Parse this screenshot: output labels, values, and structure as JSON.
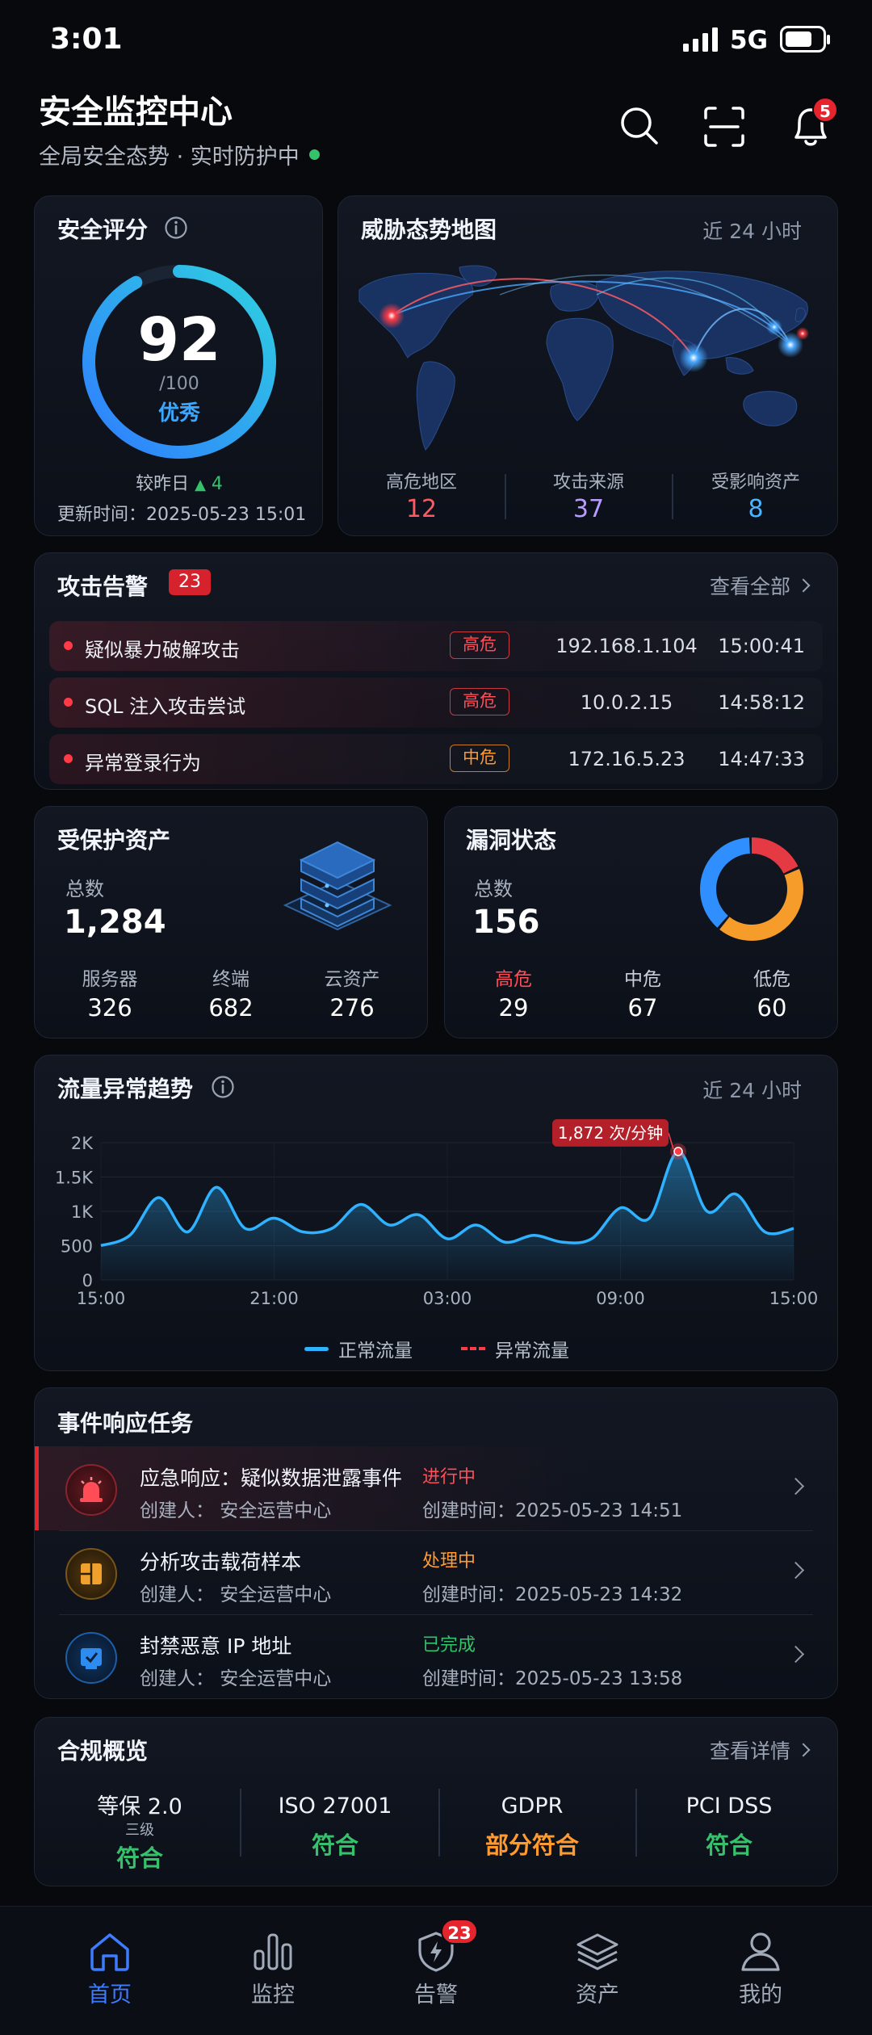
{
  "status_bar": {
    "time": "3:01",
    "network": "5G"
  },
  "header": {
    "title": "安全监控中心",
    "subtitle": "全局安全态势 · 实时防护中",
    "notification_count": "5"
  },
  "security_score": {
    "title": "安全评分",
    "score": "92",
    "max": "/100",
    "grade": "优秀",
    "compare_label": "较昨日",
    "compare_value": "4",
    "updated_label": "更新时间：",
    "updated_time": "2025-05-23 15:01",
    "percent": 0.92
  },
  "threat_map": {
    "title": "威胁态势地图",
    "range": "近 24 小时",
    "stats": [
      {
        "label": "高危地区",
        "value": "12",
        "color": "#ff5a63"
      },
      {
        "label": "攻击来源",
        "value": "37",
        "color": "#b99cff"
      },
      {
        "label": "受影响资产",
        "value": "8",
        "color": "#45b6ff"
      }
    ]
  },
  "alerts": {
    "title": "攻击告警",
    "count": "23",
    "view_all": "查看全部",
    "items": [
      {
        "title": "疑似暴力破解攻击",
        "level": "高危",
        "ip": "192.168.1.104",
        "time": "15:00:41",
        "level_color": "#ff4d57"
      },
      {
        "title": "SQL 注入攻击尝试",
        "level": "高危",
        "ip": "10.0.2.15",
        "time": "14:58:12",
        "level_color": "#ff4d57"
      },
      {
        "title": "异常登录行为",
        "level": "中危",
        "ip": "172.16.5.23",
        "time": "14:47:33",
        "level_color": "#ff9a2e"
      }
    ]
  },
  "assets": {
    "title": "受保护资产",
    "total_label": "总数",
    "total": "1,284",
    "items": [
      {
        "label": "服务器",
        "value": "326"
      },
      {
        "label": "终端",
        "value": "682"
      },
      {
        "label": "云资产",
        "value": "276"
      }
    ]
  },
  "vulns": {
    "title": "漏洞状态",
    "total_label": "总数",
    "total": "156",
    "items": [
      {
        "label": "高危",
        "value": "29",
        "color": "#ff4d57"
      },
      {
        "label": "中危",
        "value": "67",
        "color": "#c9cfd9"
      },
      {
        "label": "低危",
        "value": "60",
        "color": "#c9cfd9"
      }
    ],
    "ring_colors": [
      "#e53a44",
      "#f59c2a",
      "#2f8fff"
    ]
  },
  "traffic": {
    "title": "流量异常趋势",
    "range": "近 24 小时",
    "peak_label": "1,872 次/分钟",
    "legend_normal": "正常流量",
    "legend_abnormal": "异常流量"
  },
  "chart_data": {
    "type": "area",
    "title": "流量异常趋势",
    "x_ticks": [
      "15:00",
      "21:00",
      "03:00",
      "09:00",
      "15:00"
    ],
    "y_ticks": [
      "2K",
      "1.5K",
      "1K",
      "500",
      "0"
    ],
    "ylim": [
      0,
      2000
    ],
    "x": [
      0,
      1,
      2,
      3,
      4,
      5,
      6,
      7,
      8,
      9,
      10,
      11,
      12,
      13,
      14,
      15,
      16,
      17,
      18,
      19,
      20,
      21,
      22,
      23,
      24
    ],
    "series": [
      {
        "name": "正常流量",
        "values": [
          500,
          650,
          1200,
          700,
          1350,
          750,
          900,
          700,
          750,
          1100,
          800,
          950,
          600,
          800,
          550,
          650,
          550,
          600,
          1050,
          900,
          1872,
          1000,
          1250,
          700,
          750
        ]
      }
    ],
    "peak": {
      "x": 20,
      "y": 1872
    }
  },
  "tasks": {
    "title": "事件响应任务",
    "items": [
      {
        "title": "应急响应：疑似数据泄露事件",
        "status": "进行中",
        "status_color": "#ff4d57",
        "creator": "创建人：  安全运营中心",
        "created": "创建时间：2025-05-23 14:51",
        "icon_color": "#e53a44"
      },
      {
        "title": "分析攻击载荷样本",
        "status": "处理中",
        "status_color": "#ff9a2e",
        "creator": "创建人：  安全运营中心",
        "created": "创建时间：2025-05-23 14:32",
        "icon_color": "#f0a02c"
      },
      {
        "title": "封禁恶意 IP 地址",
        "status": "已完成",
        "status_color": "#35c26b",
        "creator": "创建人：  安全运营中心",
        "created": "创建时间：2025-05-23 13:58",
        "icon_color": "#2e8cf0"
      }
    ]
  },
  "compliance": {
    "title": "合规概览",
    "view_detail": "查看详情",
    "items": [
      {
        "name": "等保 2.0",
        "sub": "三级",
        "result": "符合",
        "color": "#35c26b"
      },
      {
        "name": "ISO 27001",
        "sub": "",
        "result": "符合",
        "color": "#35c26b"
      },
      {
        "name": "GDPR",
        "sub": "",
        "result": "部分符合",
        "color": "#ff9a2e"
      },
      {
        "name": "PCI DSS",
        "sub": "",
        "result": "符合",
        "color": "#35c26b"
      }
    ]
  },
  "tabbar": {
    "alert_badge": "23",
    "items": [
      {
        "label": "首页",
        "active": true
      },
      {
        "label": "监控",
        "active": false
      },
      {
        "label": "告警",
        "active": false
      },
      {
        "label": "资产",
        "active": false
      },
      {
        "label": "我的",
        "active": false
      }
    ]
  },
  "colors": {
    "accent": "#2f7dff",
    "danger": "#e5242d",
    "success": "#35c26b",
    "warning": "#ff9a2e",
    "chart_line": "#2fb2ff"
  }
}
